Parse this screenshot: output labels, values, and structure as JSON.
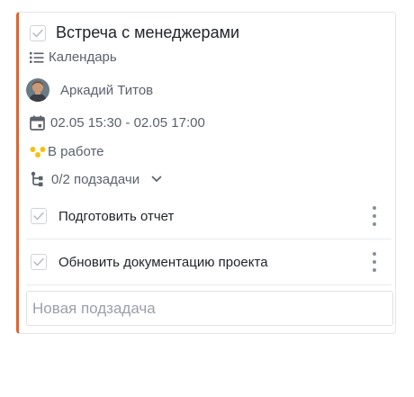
{
  "task": {
    "title": "Встреча с менеджерами",
    "accent_color": "#e0632b",
    "list_icon": "list-icon",
    "list_name": "Календарь",
    "assignee": "Аркадий Титов",
    "calendar_icon": "calendar-icon",
    "date_range": "02.05 15:30 - 02.05 17:00",
    "status_icon": "status-dots-icon",
    "status": "В работе",
    "subtasks_icon": "subtasks-icon",
    "subtasks_count": "0/2 подзадачи"
  },
  "subtasks": [
    {
      "label": "Подготовить отчет"
    },
    {
      "label": "Обновить документацию проекта"
    }
  ],
  "new_subtask": {
    "placeholder": "Новая подзадача",
    "value": ""
  }
}
